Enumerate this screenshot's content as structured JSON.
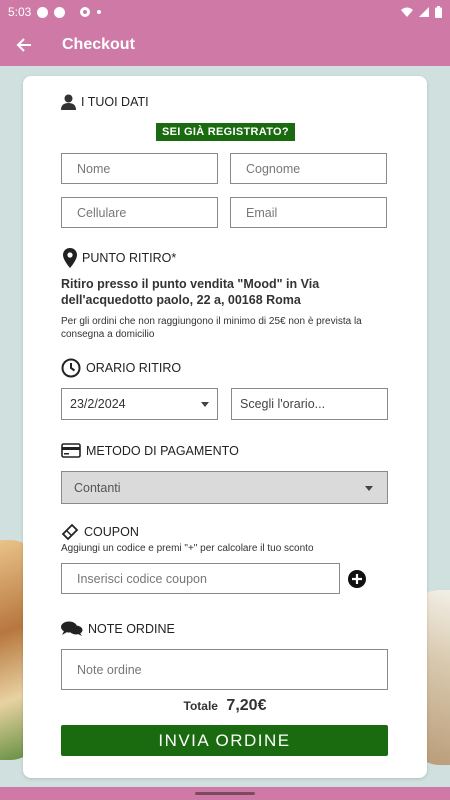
{
  "status_bar": {
    "time": "5:03"
  },
  "app_bar": {
    "title": "Checkout"
  },
  "customer": {
    "header": "I TUOI DATI",
    "registered_badge": "SEI GIÀ REGISTRATO?",
    "name_placeholder": "Nome",
    "surname_placeholder": "Cognome",
    "phone_placeholder": "Cellulare",
    "email_placeholder": "Email"
  },
  "pickup": {
    "header": "PUNTO RITIRO*",
    "location": "Ritiro presso il punto vendita \"Mood\" in Via dell'acquedotto paolo, 22 a, 00168 Roma",
    "note": "Per gli ordini che non raggiungono il minimo di 25€ non è prevista la consegna a domicilio"
  },
  "pickup_time": {
    "header": "ORARIO RITIRO",
    "date_value": "23/2/2024",
    "time_placeholder": "Scegli l'orario..."
  },
  "payment": {
    "header": "METODO DI PAGAMENTO",
    "selected": "Contanti"
  },
  "coupon": {
    "header": "COUPON",
    "hint": "Aggiungi un codice e premi \"+\" per calcolare il tuo sconto",
    "placeholder": "Inserisci codice coupon"
  },
  "notes": {
    "header": "NOTE ORDINE",
    "placeholder": "Note ordine"
  },
  "summary": {
    "total_label": "Totale",
    "total_value": "7,20€",
    "submit_label": "INVIA ORDINE"
  },
  "colors": {
    "brand_pink": "#cf7aa6",
    "accent_green": "#1a6b10"
  }
}
